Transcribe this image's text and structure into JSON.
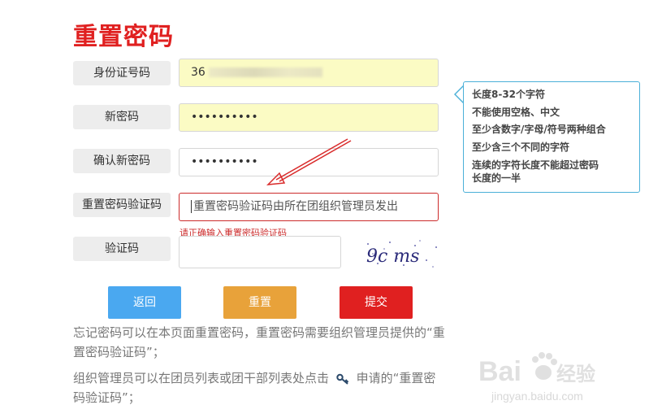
{
  "page": {
    "title": "重置密码"
  },
  "form": {
    "id_label": "身份证号码",
    "id_value_prefix": "36",
    "new_password_label": "新密码",
    "new_password_value": "••••••••••",
    "confirm_password_label": "确认新密码",
    "confirm_password_value": "••••••••••",
    "reset_code_label": "重置密码验证码",
    "reset_code_placeholder": "重置密码验证码由所在团组织管理员发出",
    "reset_code_error": "请正确输入重置密码验证码",
    "captcha_label": "验证码",
    "captcha_value": "",
    "captcha_text": "9c ms"
  },
  "tooltip": {
    "lines": [
      "长度8-32个字符",
      "不能使用空格、中文",
      "至少含数字/字母/符号两种组合",
      "至少含三个不同的字符",
      "连续的字符长度不能超过密码",
      "长度的一半"
    ]
  },
  "buttons": {
    "back": "返回",
    "reset": "重置",
    "submit": "提交"
  },
  "colors": {
    "title": "#e02020",
    "back_button": "#4aa8f0",
    "reset_button": "#e8a23a",
    "submit_button": "#e02020",
    "tooltip_border": "#4bb0d8",
    "error": "#cc2b2b"
  },
  "help": {
    "p1": "忘记密码可以在本页面重置密码，重置密码需要组织管理员提供的“重置密码验证码”；",
    "p2_before": "组织管理员可以在团员列表或团干部列表处点击",
    "p2_after": "申请的“重置密码验证码”；"
  },
  "watermark": {
    "brand": "Bai",
    "brand_suffix": "经验",
    "url": "jingyan.baidu.com"
  }
}
